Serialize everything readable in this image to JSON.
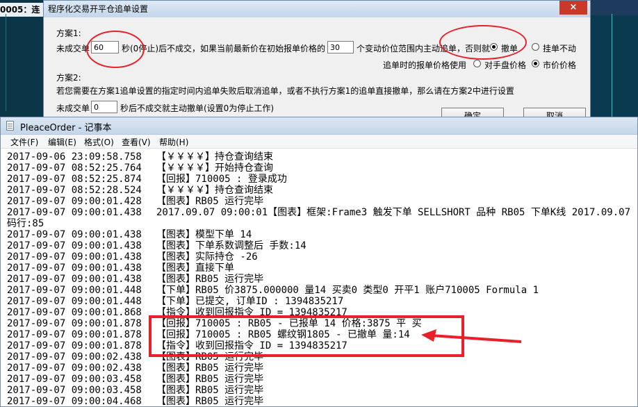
{
  "background": {
    "left_title": "0005：连"
  },
  "dialog": {
    "title": "程序化交易开平仓追单设置",
    "close_label": "×",
    "plan1_label": "方案1:",
    "unfilled_label": "未成交单",
    "seconds_value": "60",
    "seconds_suffix": "秒(0停止)后不成交，如果当前最新价在初始报单价格的",
    "ticks_value": "30",
    "ticks_suffix": "个变动价位范围内主动追单，否则就",
    "cancel_option": "撤单",
    "hold_option": "挂单不动",
    "chase_price_label": "追单时的报单价格使用",
    "counter_price_option": "对手盘价格",
    "market_price_option": "市价价格",
    "plan2_label": "方案2:",
    "plan2_desc": "若您需要在方案1追单设置的指定时间内追单失败后取消追单，或者不执行方案1的追单直接撤单，那么请在方案2中进行设置",
    "plan2_unfilled_label": "未成交单",
    "plan2_seconds_value": "0",
    "plan2_suffix": "秒后不成交就主动撤单(设置0为停止工作)",
    "ok_label": "确定",
    "cancel_label": "取消"
  },
  "notepad": {
    "title": "PleaceOrder - 记事本",
    "menu": [
      "文件(F)",
      "编辑(E)",
      "格式(O)",
      "查看(V)",
      "帮助(H)"
    ],
    "lines": [
      {
        "ts": "2017-09-06 23:09:58.758",
        "msg": "【￥￥￥￥】持仓查询结束"
      },
      {
        "ts": "2017-09-07 08:52:25.764",
        "msg": "【￥￥￥￥】开始持仓查询"
      },
      {
        "ts": "2017-09-07 08:52:25.874",
        "msg": "【回报】710005 : 登录成功"
      },
      {
        "ts": "2017-09-07 08:52:28.524",
        "msg": "【￥￥￥￥】持仓查询结束"
      },
      {
        "ts": "2017-09-07 09:00:01.428",
        "msg": "【图表】RB05 运行完毕"
      },
      {
        "ts": "2017-09-07 09:00:01.438",
        "msg": "2017.09.07 09:00:01【图表】框架:Frame3 触发下单 SELLSHORT 品种 RB05 下单K线 2017.09.07"
      },
      {
        "ts": "码行:85",
        "msg": ""
      },
      {
        "ts": "2017-09-07 09:00:01.438",
        "msg": "【图表】模型下单 14"
      },
      {
        "ts": "2017-09-07 09:00:01.438",
        "msg": "【图表】下单系数调整后 手数:14"
      },
      {
        "ts": "2017-09-07 09:00:01.438",
        "msg": "【图表】实际持仓 -26"
      },
      {
        "ts": "2017-09-07 09:00:01.438",
        "msg": "【图表】直接下单"
      },
      {
        "ts": "2017-09-07 09:00:01.438",
        "msg": "【图表】RB05 运行完毕"
      },
      {
        "ts": "2017-09-07 09:00:01.448",
        "msg": "【下单】RB05 价3875.000000 量14 买卖0 类型0 开平1 账户710005 Formula 1"
      },
      {
        "ts": "2017-09-07 09:00:01.448",
        "msg": "【下单】已提交, 订单ID : 1394835217"
      },
      {
        "ts": "2017-09-07 09:00:01.868",
        "msg": "【指令】收到回报指令 ID = 1394835217"
      },
      {
        "ts": "2017-09-07 09:00:01.878",
        "msg": "【回报】710005 : RB05 - 已报单 14 价格:3875 平 买"
      },
      {
        "ts": "2017-09-07 09:00:01.878",
        "msg": "【回报】710005 : RB05 螺纹钢1805 - 已撤单 量:14"
      },
      {
        "ts": "2017-09-07 09:00:01.878",
        "msg": "【指令】收到回报指令 ID = 1394835217"
      },
      {
        "ts": "2017-09-07 09:00:02.438",
        "msg": "【图表】RB05 运行完毕"
      },
      {
        "ts": "2017-09-07 09:00:02.438",
        "msg": "【图表】RB05 运行完毕"
      },
      {
        "ts": "2017-09-07 09:00:03.458",
        "msg": "【图表】RB05 运行完毕"
      },
      {
        "ts": "2017-09-07 09:00:03.458",
        "msg": "【图表】RB05 运行完毕"
      },
      {
        "ts": "2017-09-07 09:00:04.468",
        "msg": "【图表】RB05 运行完毕"
      }
    ]
  },
  "colors": {
    "annotation_red": "#e8202a"
  }
}
